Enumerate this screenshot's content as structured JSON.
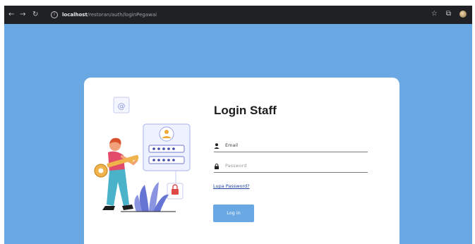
{
  "browser": {
    "back_icon": "arrow-left-icon",
    "forward_icon": "arrow-right-icon",
    "reload_icon": "reload-icon",
    "url_host": "localhost",
    "url_path": "/restoran/auth/loginPegawai",
    "icons": [
      "star-icon",
      "extensions-icon",
      "profile-avatar-icon"
    ]
  },
  "login": {
    "title": "Login Staff",
    "email_placeholder": "Email",
    "password_placeholder": "Password",
    "forgot_link": "Lupa Password?",
    "login_button": "Log in"
  },
  "colors": {
    "background": "#6aa8e4",
    "card": "#ffffff",
    "button": "#6aa8e4",
    "link": "#1f3fa0"
  }
}
